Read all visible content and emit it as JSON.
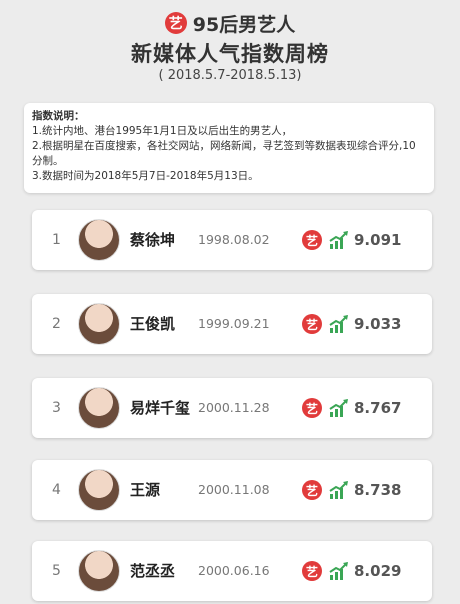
{
  "header": {
    "logo_char": "艺",
    "title_line1": "95后男艺人",
    "title_line2": "新媒体人气指数周榜",
    "date_range": "( 2018.5.7-2018.5.13)"
  },
  "notes": {
    "title": "指数说明：",
    "lines": [
      "1.统计内地、港台1995年1月1日及以后出生的男艺人，",
      "2.根据明星在百度搜索，各社交网站，网络新闻，寻艺签到等数据表现综合评分,10分制。",
      "3.数据时间为2018年5月7日-2018年5月13日。"
    ]
  },
  "ranking": [
    {
      "rank": "1",
      "name": "蔡徐坤",
      "birthday": "1998.08.02",
      "badge": "艺",
      "score": "9.091"
    },
    {
      "rank": "2",
      "name": "王俊凯",
      "birthday": "1999.09.21",
      "badge": "艺",
      "score": "9.033"
    },
    {
      "rank": "3",
      "name": "易烊千玺",
      "birthday": "2000.11.28",
      "badge": "艺",
      "score": "8.767"
    },
    {
      "rank": "4",
      "name": "王源",
      "birthday": "2000.11.08",
      "badge": "艺",
      "score": "8.738"
    },
    {
      "rank": "5",
      "name": "范丞丞",
      "birthday": "2000.06.16",
      "badge": "艺",
      "score": "8.029"
    }
  ],
  "colors": {
    "brand_red": "#e13b3b",
    "trend_green": "#3aa655",
    "background": "#ececec"
  },
  "icons": {
    "logo": "yi-logo-icon",
    "trend": "trend-up-icon"
  }
}
